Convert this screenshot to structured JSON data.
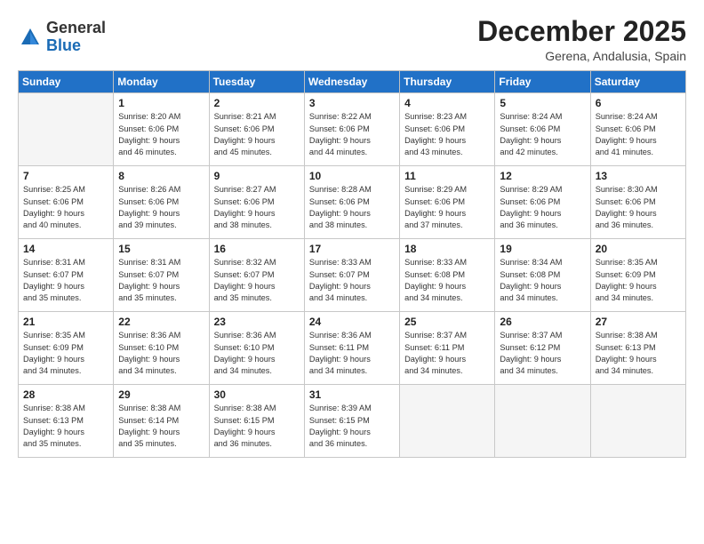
{
  "header": {
    "logo_general": "General",
    "logo_blue": "Blue",
    "month_title": "December 2025",
    "location": "Gerena, Andalusia, Spain"
  },
  "weekdays": [
    "Sunday",
    "Monday",
    "Tuesday",
    "Wednesday",
    "Thursday",
    "Friday",
    "Saturday"
  ],
  "weeks": [
    [
      {
        "day": "",
        "info": ""
      },
      {
        "day": "1",
        "info": "Sunrise: 8:20 AM\nSunset: 6:06 PM\nDaylight: 9 hours\nand 46 minutes."
      },
      {
        "day": "2",
        "info": "Sunrise: 8:21 AM\nSunset: 6:06 PM\nDaylight: 9 hours\nand 45 minutes."
      },
      {
        "day": "3",
        "info": "Sunrise: 8:22 AM\nSunset: 6:06 PM\nDaylight: 9 hours\nand 44 minutes."
      },
      {
        "day": "4",
        "info": "Sunrise: 8:23 AM\nSunset: 6:06 PM\nDaylight: 9 hours\nand 43 minutes."
      },
      {
        "day": "5",
        "info": "Sunrise: 8:24 AM\nSunset: 6:06 PM\nDaylight: 9 hours\nand 42 minutes."
      },
      {
        "day": "6",
        "info": "Sunrise: 8:24 AM\nSunset: 6:06 PM\nDaylight: 9 hours\nand 41 minutes."
      }
    ],
    [
      {
        "day": "7",
        "info": "Sunrise: 8:25 AM\nSunset: 6:06 PM\nDaylight: 9 hours\nand 40 minutes."
      },
      {
        "day": "8",
        "info": "Sunrise: 8:26 AM\nSunset: 6:06 PM\nDaylight: 9 hours\nand 39 minutes."
      },
      {
        "day": "9",
        "info": "Sunrise: 8:27 AM\nSunset: 6:06 PM\nDaylight: 9 hours\nand 38 minutes."
      },
      {
        "day": "10",
        "info": "Sunrise: 8:28 AM\nSunset: 6:06 PM\nDaylight: 9 hours\nand 38 minutes."
      },
      {
        "day": "11",
        "info": "Sunrise: 8:29 AM\nSunset: 6:06 PM\nDaylight: 9 hours\nand 37 minutes."
      },
      {
        "day": "12",
        "info": "Sunrise: 8:29 AM\nSunset: 6:06 PM\nDaylight: 9 hours\nand 36 minutes."
      },
      {
        "day": "13",
        "info": "Sunrise: 8:30 AM\nSunset: 6:06 PM\nDaylight: 9 hours\nand 36 minutes."
      }
    ],
    [
      {
        "day": "14",
        "info": "Sunrise: 8:31 AM\nSunset: 6:07 PM\nDaylight: 9 hours\nand 35 minutes."
      },
      {
        "day": "15",
        "info": "Sunrise: 8:31 AM\nSunset: 6:07 PM\nDaylight: 9 hours\nand 35 minutes."
      },
      {
        "day": "16",
        "info": "Sunrise: 8:32 AM\nSunset: 6:07 PM\nDaylight: 9 hours\nand 35 minutes."
      },
      {
        "day": "17",
        "info": "Sunrise: 8:33 AM\nSunset: 6:07 PM\nDaylight: 9 hours\nand 34 minutes."
      },
      {
        "day": "18",
        "info": "Sunrise: 8:33 AM\nSunset: 6:08 PM\nDaylight: 9 hours\nand 34 minutes."
      },
      {
        "day": "19",
        "info": "Sunrise: 8:34 AM\nSunset: 6:08 PM\nDaylight: 9 hours\nand 34 minutes."
      },
      {
        "day": "20",
        "info": "Sunrise: 8:35 AM\nSunset: 6:09 PM\nDaylight: 9 hours\nand 34 minutes."
      }
    ],
    [
      {
        "day": "21",
        "info": "Sunrise: 8:35 AM\nSunset: 6:09 PM\nDaylight: 9 hours\nand 34 minutes."
      },
      {
        "day": "22",
        "info": "Sunrise: 8:36 AM\nSunset: 6:10 PM\nDaylight: 9 hours\nand 34 minutes."
      },
      {
        "day": "23",
        "info": "Sunrise: 8:36 AM\nSunset: 6:10 PM\nDaylight: 9 hours\nand 34 minutes."
      },
      {
        "day": "24",
        "info": "Sunrise: 8:36 AM\nSunset: 6:11 PM\nDaylight: 9 hours\nand 34 minutes."
      },
      {
        "day": "25",
        "info": "Sunrise: 8:37 AM\nSunset: 6:11 PM\nDaylight: 9 hours\nand 34 minutes."
      },
      {
        "day": "26",
        "info": "Sunrise: 8:37 AM\nSunset: 6:12 PM\nDaylight: 9 hours\nand 34 minutes."
      },
      {
        "day": "27",
        "info": "Sunrise: 8:38 AM\nSunset: 6:13 PM\nDaylight: 9 hours\nand 34 minutes."
      }
    ],
    [
      {
        "day": "28",
        "info": "Sunrise: 8:38 AM\nSunset: 6:13 PM\nDaylight: 9 hours\nand 35 minutes."
      },
      {
        "day": "29",
        "info": "Sunrise: 8:38 AM\nSunset: 6:14 PM\nDaylight: 9 hours\nand 35 minutes."
      },
      {
        "day": "30",
        "info": "Sunrise: 8:38 AM\nSunset: 6:15 PM\nDaylight: 9 hours\nand 36 minutes."
      },
      {
        "day": "31",
        "info": "Sunrise: 8:39 AM\nSunset: 6:15 PM\nDaylight: 9 hours\nand 36 minutes."
      },
      {
        "day": "",
        "info": ""
      },
      {
        "day": "",
        "info": ""
      },
      {
        "day": "",
        "info": ""
      }
    ]
  ]
}
